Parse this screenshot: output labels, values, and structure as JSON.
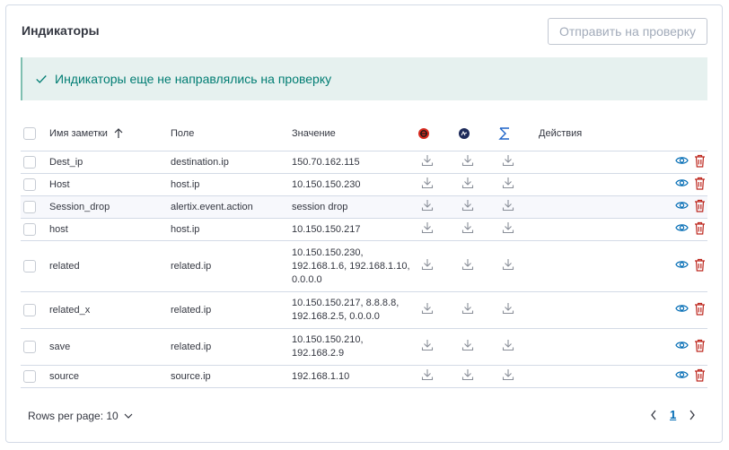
{
  "panel": {
    "title": "Индикаторы",
    "send_button_label": "Отправить на проверку",
    "callout_text": "Индикаторы еще не направлялись на проверку"
  },
  "table": {
    "columns": {
      "name": "Имя заметки",
      "field": "Поле",
      "value": "Значение",
      "actions": "Действия"
    },
    "header_icons": [
      "red-circle-logo-icon",
      "navy-circle-logo-icon",
      "sigma-icon"
    ],
    "rows": [
      {
        "name": "Dest_ip",
        "field": "destination.ip",
        "value": "150.70.162.115"
      },
      {
        "name": "Host",
        "field": "host.ip",
        "value": "10.150.150.230"
      },
      {
        "name": "Session_drop",
        "field": "alertix.event.action",
        "value": "session drop"
      },
      {
        "name": "host",
        "field": "host.ip",
        "value": "10.150.150.217"
      },
      {
        "name": "related",
        "field": "related.ip",
        "value": [
          "10.150.150.230,",
          "192.168.1.6, 192.168.1.10,",
          "0.0.0.0"
        ]
      },
      {
        "name": "related_x",
        "field": "related.ip",
        "value": [
          "10.150.150.217, 8.8.8.8,",
          "192.168.2.5, 0.0.0.0"
        ]
      },
      {
        "name": "save",
        "field": "related.ip",
        "value": [
          "10.150.150.210,",
          "192.168.2.9"
        ]
      },
      {
        "name": "source",
        "field": "source.ip",
        "value": "192.168.1.10"
      }
    ]
  },
  "footer": {
    "rows_per_page": "Rows per page: 10",
    "current_page": "1"
  },
  "colors": {
    "accent": "#006bb4",
    "success": "#017d73",
    "danger": "#bd271e"
  }
}
